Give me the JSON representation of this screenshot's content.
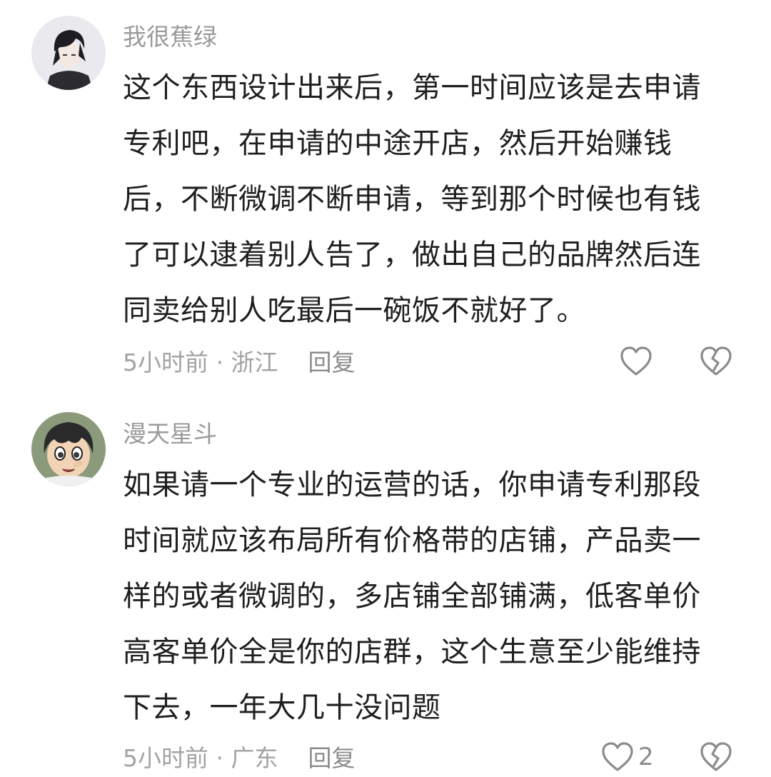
{
  "comments": [
    {
      "username": "我很蕉绿",
      "avatar_icon": "avatar-anime-dark-hair",
      "lines": [
        "这个东西设计出来后，第一时间应该是去申请",
        "专利吧，在申请的中途开店，然后开始赚钱",
        "后，不断微调不断申请，等到那个时候也有钱",
        "了可以逮着别人告了，做出自己的品牌然后连",
        "同卖给别人吃最后一碗饭不就好了。"
      ],
      "time": "5小时前",
      "separator": " · ",
      "location": "浙江",
      "reply_label": "回复",
      "like_count": "",
      "like_icon": "heart-outline-icon",
      "dislike_icon": "broken-heart-icon"
    },
    {
      "username": "漫天星斗",
      "avatar_icon": "avatar-anime-boy",
      "lines": [
        "如果请一个专业的运营的话，你申请专利那段",
        "时间就应该布局所有价格带的店铺，产品卖一",
        "样的或者微调的，多店铺全部铺满，低客单价",
        "高客单价全是你的店群，这个生意至少能维持",
        "下去，一年大几十没问题"
      ],
      "time": "5小时前",
      "separator": " · ",
      "location": "广东",
      "reply_label": "回复",
      "like_count": "2",
      "like_icon": "heart-outline-icon",
      "dislike_icon": "broken-heart-icon"
    }
  ],
  "colors": {
    "text": "#1f1f1f",
    "muted": "#9a9a9a",
    "icon": "#8b8b8b"
  }
}
